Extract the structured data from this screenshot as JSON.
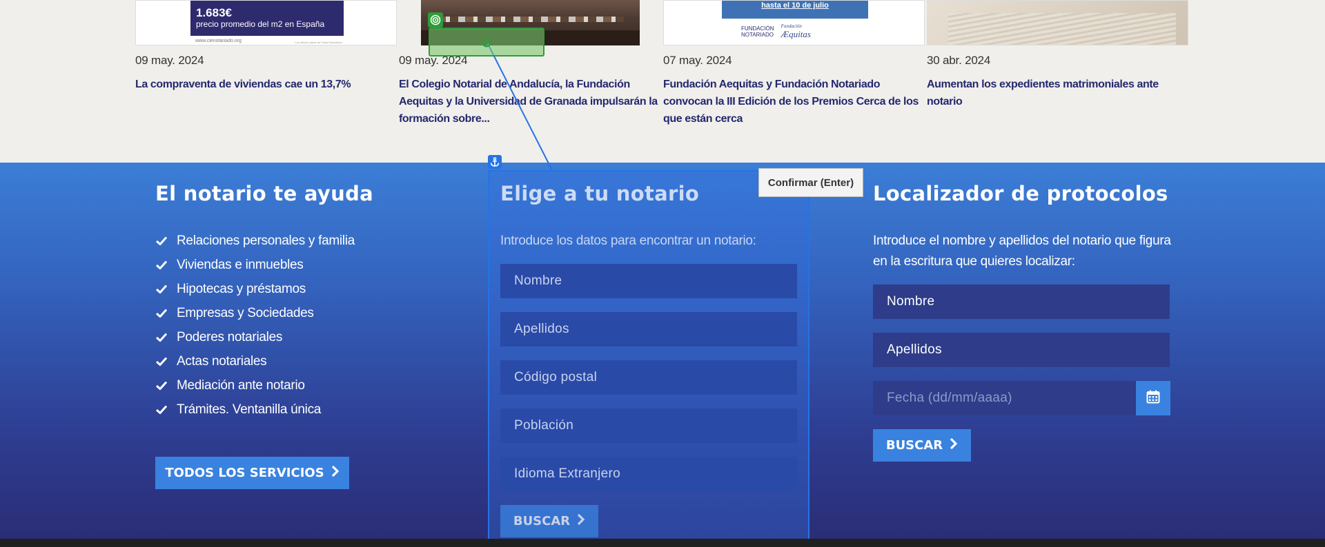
{
  "news": [
    {
      "date": "09 may. 2024",
      "title": "La compraventa de viviendas cae un 13,7%",
      "thumb": {
        "price": "1.683€",
        "caption": "precio promedio del m2 en España",
        "site": "www.cienotariado.org",
        "fine": "Los ultimos datos de Portal Estadistico"
      }
    },
    {
      "date": "09 may. 2024",
      "title": "El Colegio Notarial de Andalucía, la Fundación Aequitas y la Universidad de Granada impulsarán la formación sobre..."
    },
    {
      "date": "07 may. 2024",
      "title": "Fundación Aequitas y Fundación Notariado convocan la III Edición de los Premios Cerca de los que están cerca",
      "thumb": {
        "banner": "hasta el 10 de julio",
        "logo1a": "FUNDACIÓN",
        "logo1b": "NOTARIADO",
        "logo2a": "Fundación",
        "logo2b": "Æquitas"
      }
    },
    {
      "date": "30 abr. 2024",
      "title": "Aumentan los expedientes matrimoniales ante notario"
    }
  ],
  "help": {
    "title": "El notario te ayuda",
    "items": [
      "Relaciones personales y familia",
      "Viviendas e inmuebles",
      "Hipotecas y préstamos",
      "Empresas y Sociedades",
      "Poderes notariales",
      "Actas notariales",
      "Mediación ante notario",
      "Trámites. Ventanilla única"
    ],
    "button": "TODOS LOS SERVICIOS"
  },
  "choose": {
    "title": "Elige a tu notario",
    "lead": "Introduce los datos para encontrar un notario:",
    "fields": [
      "Nombre",
      "Apellidos",
      "Código postal",
      "Población",
      "Idioma Extranjero"
    ],
    "button": "BUSCAR"
  },
  "locator": {
    "title": "Localizador de protocolos",
    "lead": "Introduce el nombre y apellidos del notario que figura en la escritura que quieres localizar:",
    "fields": [
      "Nombre",
      "Apellidos",
      "Fecha (dd/mm/aaaa)"
    ],
    "button": "BUSCAR"
  },
  "overlay": {
    "confirm": "Confirmar (Enter)"
  },
  "colors": {
    "accent": "#3a82df",
    "title_dark": "#24286e",
    "selection": "#2573e6",
    "highlight": "#2f9b3a"
  },
  "icons": [
    "check-icon",
    "chevron-right-icon",
    "calendar-icon",
    "anchor-icon",
    "target-icon"
  ]
}
